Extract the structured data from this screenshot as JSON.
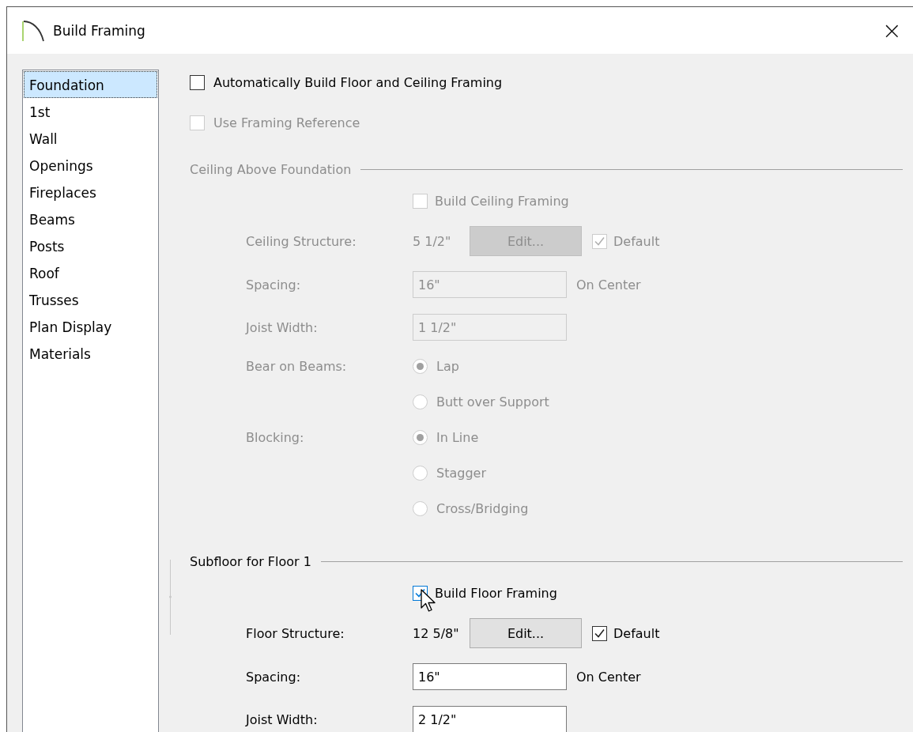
{
  "window": {
    "title": "Build Framing",
    "close": "×"
  },
  "sidebar": {
    "items": [
      {
        "label": "Foundation",
        "selected": true
      },
      {
        "label": "1st",
        "selected": false
      },
      {
        "label": "Wall",
        "selected": false
      },
      {
        "label": "Openings",
        "selected": false
      },
      {
        "label": "Fireplaces",
        "selected": false
      },
      {
        "label": "Beams",
        "selected": false
      },
      {
        "label": "Posts",
        "selected": false
      },
      {
        "label": "Roof",
        "selected": false
      },
      {
        "label": "Trusses",
        "selected": false
      },
      {
        "label": "Plan Display",
        "selected": false
      },
      {
        "label": "Materials",
        "selected": false
      }
    ]
  },
  "options": [
    {
      "label": "Automatically Build Floor and Ceiling Framing",
      "checked": false,
      "disabled": false
    },
    {
      "label": "Use Framing Reference",
      "checked": false,
      "disabled": true
    }
  ],
  "sections": [
    {
      "title": "Ceiling Above Foundation",
      "disabled": true,
      "build": {
        "label": "Build Ceiling Framing",
        "checked": false,
        "focused": false
      },
      "rows": [
        {
          "kind": "structure",
          "label": "Ceiling Structure:",
          "value": "5 1/2\"",
          "button": "Edit...",
          "default": {
            "label": "Default",
            "checked": true
          }
        },
        {
          "kind": "field",
          "label": "Spacing:",
          "value": "16\"",
          "suffix": "On Center"
        },
        {
          "kind": "field",
          "label": "Joist Width:",
          "value": "1 1/2\""
        },
        {
          "kind": "radio",
          "label": "Bear on Beams:",
          "options": [
            {
              "label": "Lap",
              "selected": true
            },
            {
              "label": "Butt over Support",
              "selected": false
            }
          ]
        },
        {
          "kind": "radio",
          "label": "Blocking:",
          "options": [
            {
              "label": "In Line",
              "selected": true
            },
            {
              "label": "Stagger",
              "selected": false
            },
            {
              "label": "Cross/Bridging",
              "selected": false
            }
          ]
        }
      ]
    },
    {
      "title": "Subfloor for Floor 1",
      "disabled": false,
      "build": {
        "label": "Build Floor Framing",
        "checked": true,
        "focused": true
      },
      "rows": [
        {
          "kind": "structure",
          "label": "Floor Structure:",
          "value": "12 5/8\"",
          "button": "Edit...",
          "default": {
            "label": "Default",
            "checked": true
          }
        },
        {
          "kind": "field",
          "label": "Spacing:",
          "value": "16\"",
          "suffix": "On Center"
        },
        {
          "kind": "field",
          "label": "Joist Width:",
          "value": "2 1/2\""
        }
      ]
    }
  ]
}
